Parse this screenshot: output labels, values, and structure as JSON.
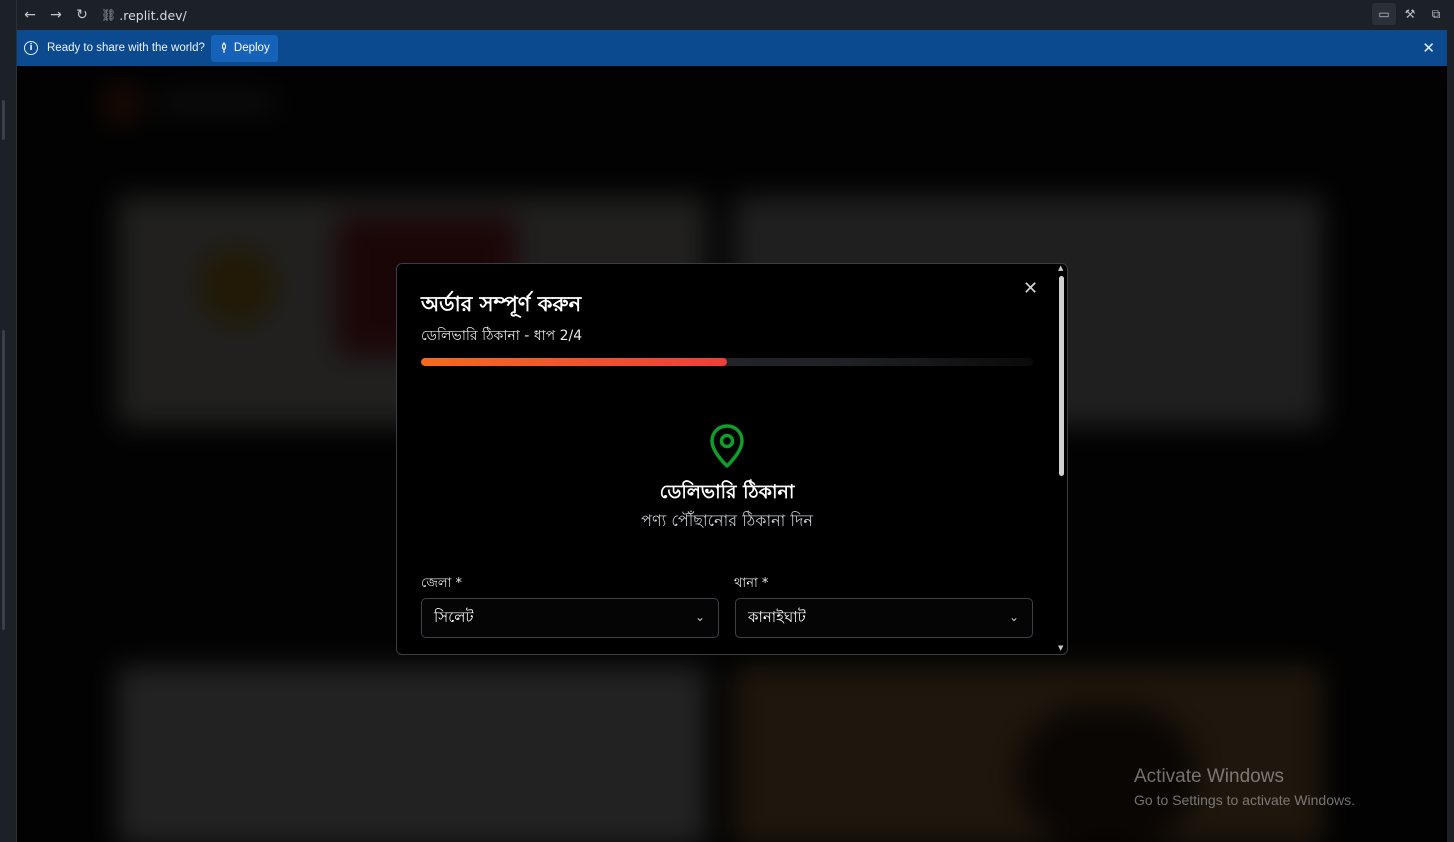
{
  "browser": {
    "url": ".replit.dev/"
  },
  "banner": {
    "message": "Ready to share with the world?",
    "deploy_label": "Deploy"
  },
  "modal": {
    "title": "অর্ডার সম্পূর্ণ করুন",
    "subtitle": "ডেলিভারি ঠিকানা - ধাপ 2/4",
    "progress_fraction": 0.5,
    "section_title": "ডেলিভারি ঠিকানা",
    "section_subtitle": "পণ্য পৌঁছানোর ঠিকানা দিন",
    "district_label": "জেলা *",
    "district_value": "সিলেট",
    "thana_label": "থানা *",
    "thana_value": "কানাইঘাট"
  },
  "colors": {
    "banner": "#0b4a8e",
    "progress_start": "#f46b1d",
    "progress_end": "#ef3e3a",
    "pin": "#0f9d2c"
  },
  "watermark": {
    "line1": "Activate Windows",
    "line2": "Go to Settings to activate Windows."
  }
}
